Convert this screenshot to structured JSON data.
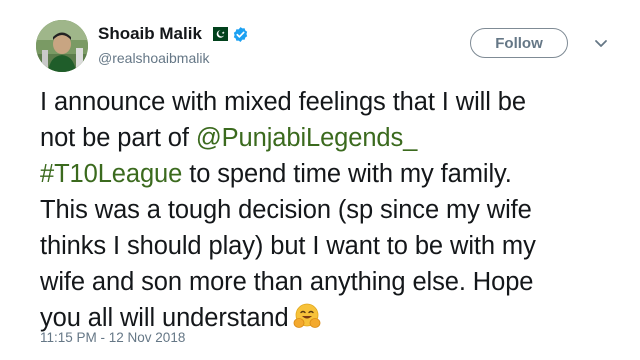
{
  "author": {
    "display_name": "Shoaib Malik",
    "handle": "@realshoaibmalik",
    "flag_icon": "pakistan-flag-icon",
    "verified_icon": "verified-badge-icon"
  },
  "follow_button": {
    "label": "Follow"
  },
  "menu": {
    "icon": "chevron-down-icon"
  },
  "tweet": {
    "line1": "I announce with mixed feelings that I will be",
    "line2_prefix": "not be part of ",
    "mention": "@PunjabiLegends_",
    "hashtag": "#T10League",
    "line3_suffix": " to spend time with my family.",
    "line4": "This was a tough decision (sp since my wife",
    "line5": "thinks I should play) but I want to be with my",
    "line6": "wife and son more than anything else. Hope",
    "line7": "you all will understand",
    "emoji": "hugging-face-emoji"
  },
  "timestamp": "11:15 PM - 12 Nov 2018",
  "colors": {
    "link": "#3b6a1e",
    "muted": "#657786",
    "verified": "#1da1f2",
    "flag_green": "#01411c"
  }
}
